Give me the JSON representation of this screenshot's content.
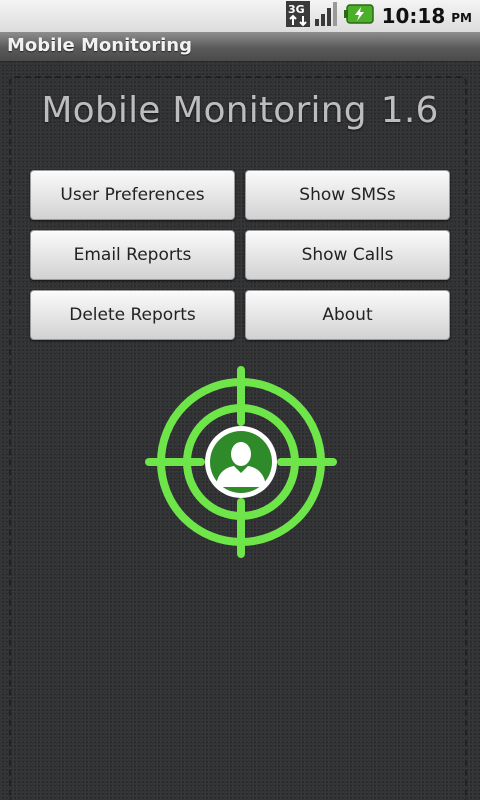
{
  "status_bar": {
    "network_icon": "3g-data-icon",
    "signal_icon": "signal-bars-icon",
    "battery_icon": "battery-charging-icon",
    "time": "10:18",
    "ampm": "PM"
  },
  "window": {
    "title": "Mobile Monitoring"
  },
  "main": {
    "app_name": "Mobile Monitoring",
    "version": "1.6",
    "logo_icon": "crosshair-target-person-icon",
    "accent_color": "#6ee64a",
    "buttons": [
      {
        "label": "User Preferences"
      },
      {
        "label": "Show SMSs"
      },
      {
        "label": "Email Reports"
      },
      {
        "label": "Show Calls"
      },
      {
        "label": "Delete Reports"
      },
      {
        "label": "About"
      }
    ]
  }
}
